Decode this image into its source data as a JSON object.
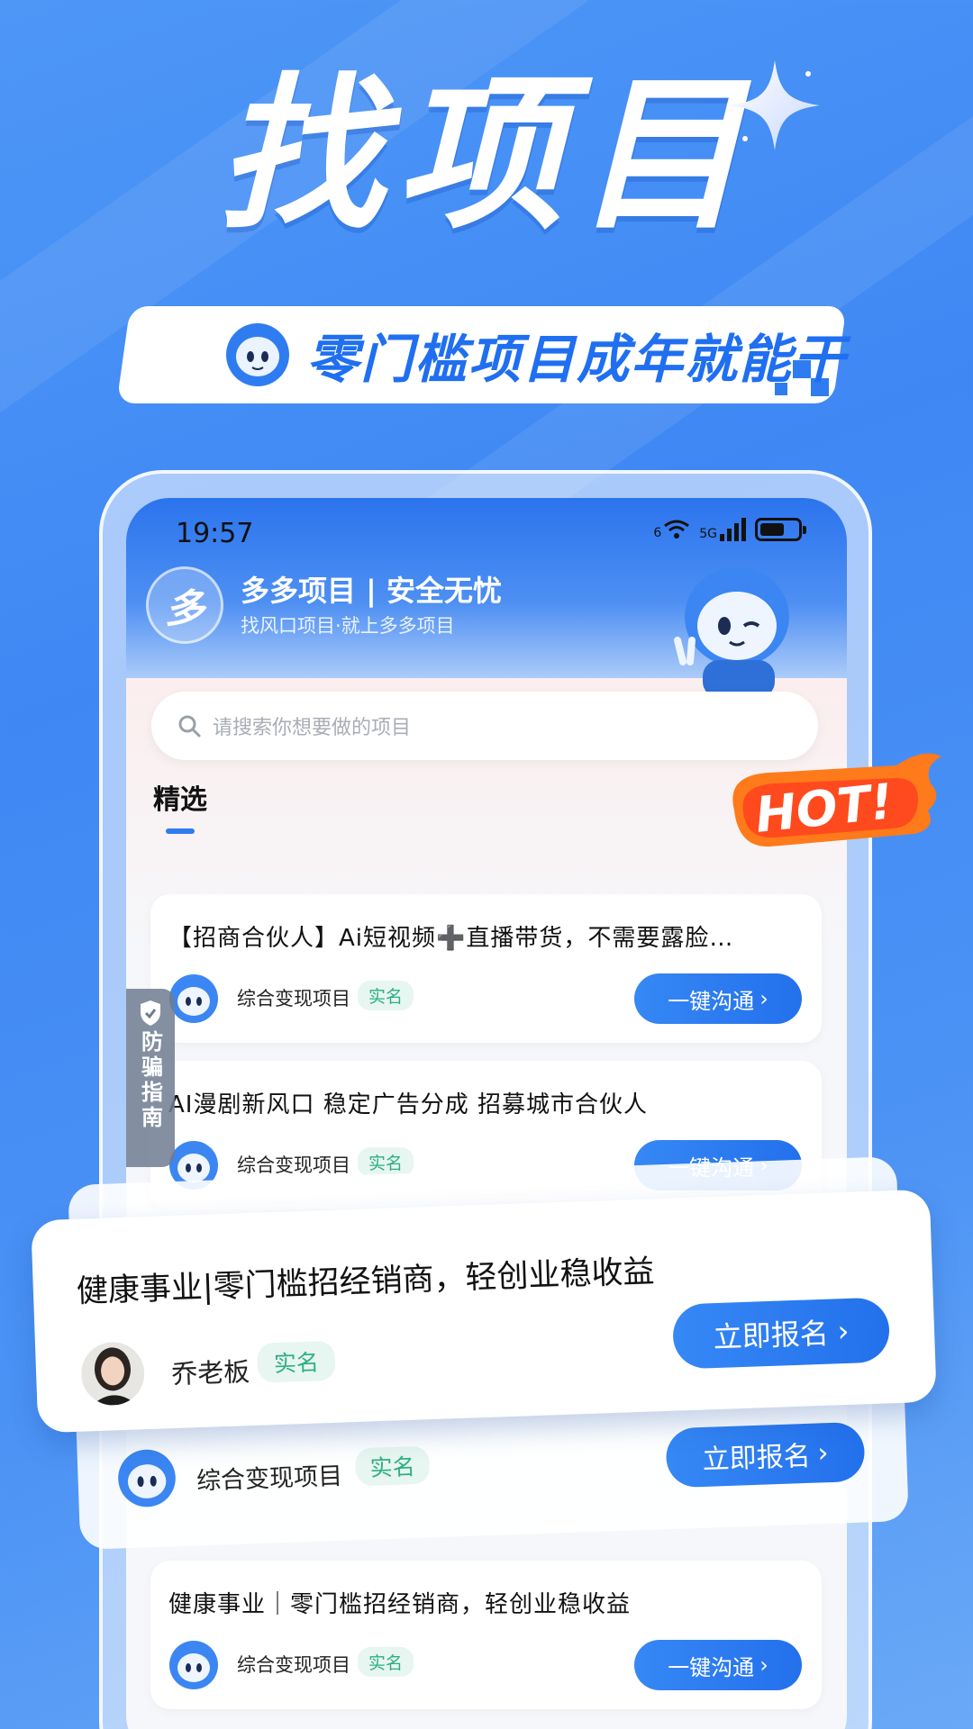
{
  "hero": {
    "headline": "找项目",
    "banner_text": "零门槛项目成年就能干"
  },
  "status_bar": {
    "time": "19:57",
    "wifi_label": "6",
    "network_label": "5G"
  },
  "app_header": {
    "logo_char": "多",
    "title": "多多项目 | 安全无忧",
    "subtitle": "找风口项目·就上多多项目"
  },
  "search": {
    "placeholder": "请搜索你想要做的项目"
  },
  "tabs": [
    {
      "label": "精选",
      "selected": true
    }
  ],
  "hot_badge": "HOT!",
  "anti_fraud": {
    "label": "防骗指南"
  },
  "projects": [
    {
      "title": "【招商合伙人】Ai短视频➕直播带货，不需要露脸…",
      "category": "综合变现项目",
      "badge": "实名",
      "cta": "一键沟通"
    },
    {
      "title": "AI漫剧新风口 稳定广告分成 招募城市合伙人",
      "category": "综合变现项目",
      "badge": "实名",
      "cta": "一键沟通"
    },
    {
      "title": "健康事业｜零门槛招经销商，轻创业稳收益",
      "category": "综合变现项目",
      "badge": "实名",
      "cta": "一键沟通"
    }
  ],
  "featured_card": {
    "title": "健康事业|零门槛招经销商，轻创业稳收益",
    "owner": "乔老板",
    "badge": "实名",
    "cta": "立即报名"
  },
  "featured_back_card": {
    "category": "综合变现项目",
    "badge": "实名",
    "cta": "立即报名"
  },
  "colors": {
    "brand_blue": "#2f7cf0",
    "badge_green": "#2fae86",
    "badge_bg": "#e7f6f0"
  }
}
